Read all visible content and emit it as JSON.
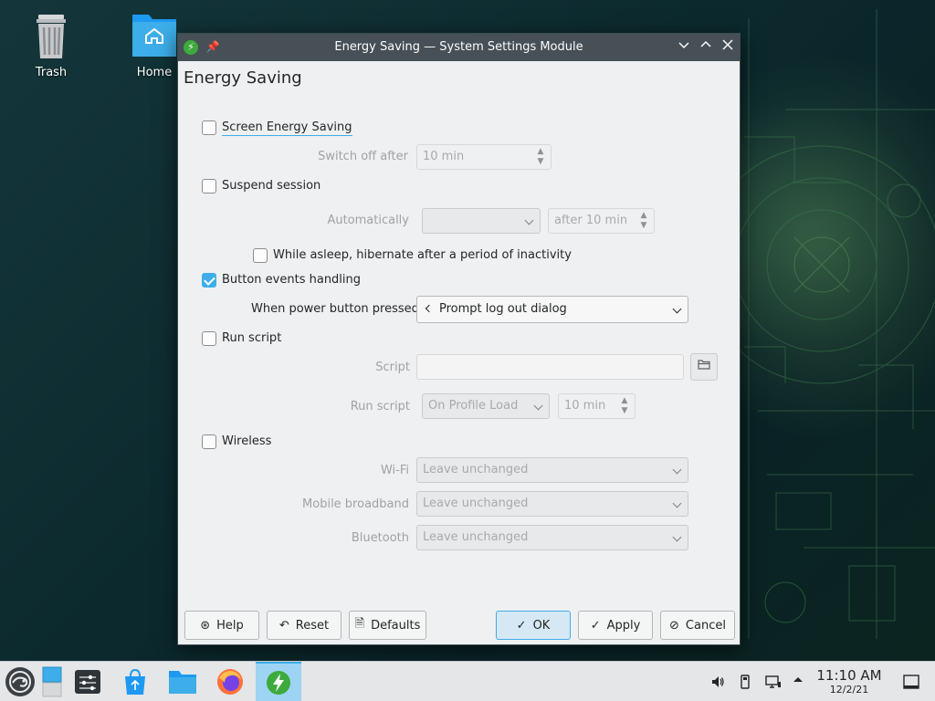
{
  "desktop": {
    "icons": [
      {
        "label": "Trash"
      },
      {
        "label": "Home"
      }
    ]
  },
  "window": {
    "title": "Energy Saving — System Settings Module",
    "heading": "Energy Saving",
    "screen_energy_saving": {
      "label": "Screen Energy Saving",
      "checked": false,
      "switch_off_label": "Switch off after",
      "switch_off_value": "10 min"
    },
    "suspend_session": {
      "label": "Suspend session",
      "checked": false,
      "automatically_label": "Automatically",
      "automatically_value": "",
      "after_value": "after 10 min",
      "hibernate_label": "While asleep, hibernate after a period of inactivity",
      "hibernate_checked": false
    },
    "button_events": {
      "label": "Button events handling",
      "checked": true,
      "power_button_label": "When power button pressed",
      "power_button_value": "Prompt log out dialog"
    },
    "run_script": {
      "label": "Run script",
      "checked": false,
      "script_label": "Script",
      "script_value": "",
      "run_script_label": "Run script",
      "run_script_when": "On Profile Load",
      "run_script_delay": "10 min"
    },
    "wireless": {
      "label": "Wireless",
      "checked": false,
      "wifi_label": "Wi-Fi",
      "wifi_value": "Leave unchanged",
      "mobile_label": "Mobile broadband",
      "mobile_value": "Leave unchanged",
      "bluetooth_label": "Bluetooth",
      "bluetooth_value": "Leave unchanged"
    },
    "buttons": {
      "help": "Help",
      "reset": "Reset",
      "defaults": "Defaults",
      "ok": "OK",
      "apply": "Apply",
      "cancel": "Cancel"
    }
  },
  "taskbar": {
    "time": "11:10 AM",
    "date": "12/2/21",
    "accent": "#3daee9"
  }
}
